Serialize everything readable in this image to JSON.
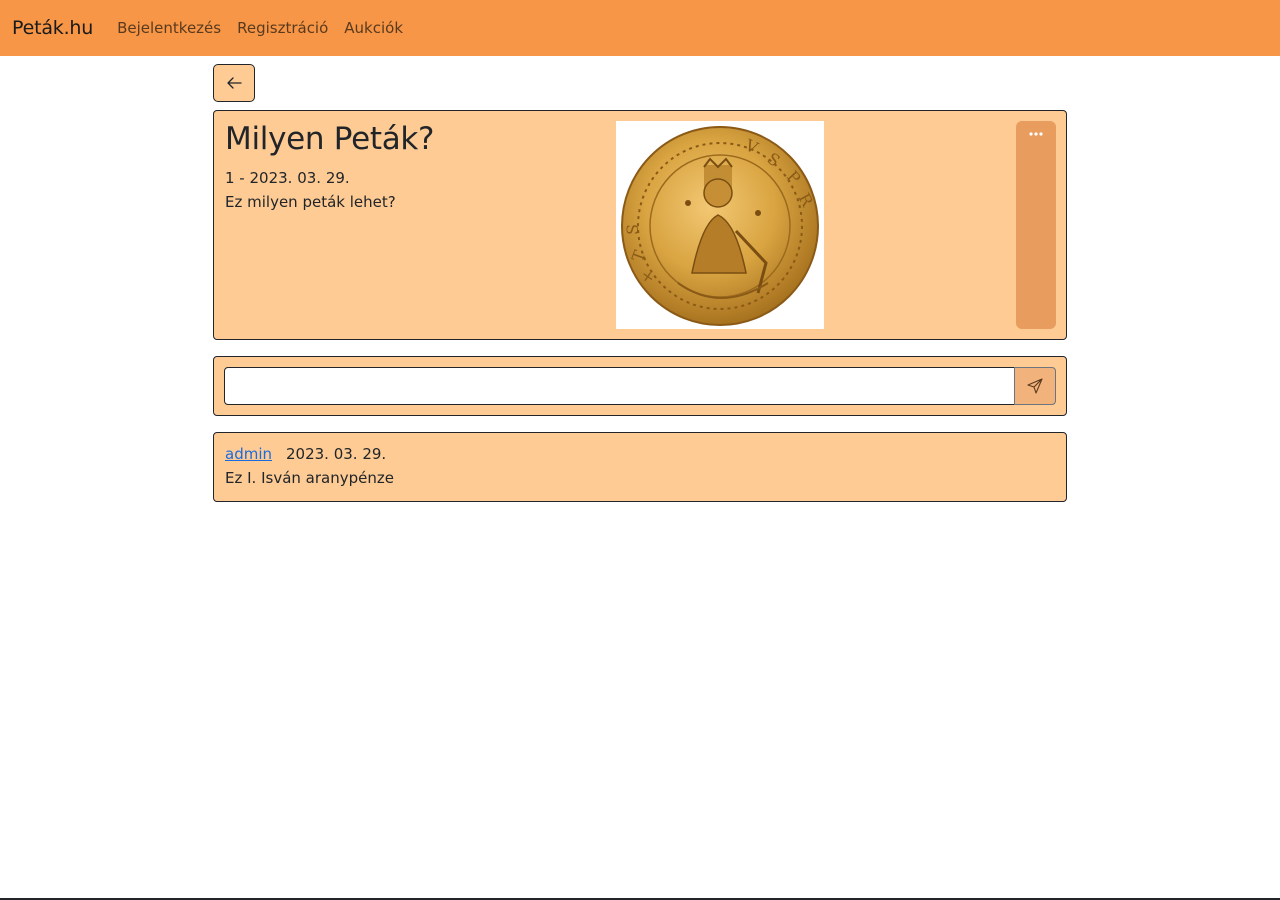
{
  "navbar": {
    "brand": "Peták.hu",
    "links": [
      "Bejelentkezés",
      "Regisztráció",
      "Aukciók"
    ]
  },
  "post": {
    "title": "Milyen Peták?",
    "meta": "1 - 2023. 03. 29.",
    "body": "Ez milyen peták lehet?",
    "image_subject": "gold coin"
  },
  "comment_form": {
    "value": "",
    "placeholder": ""
  },
  "comments": [
    {
      "author": "admin",
      "date": "2023. 03. 29.",
      "text": "Ez I. Isván aranypénze"
    }
  ],
  "colors": {
    "navbar": "#f79646",
    "card": "#fecb94",
    "more_button": "#e89c5e",
    "send_button": "#f2b27c",
    "link": "#1a6be0",
    "coin_gold": "#d9a441"
  },
  "icons": {
    "back": "arrow-left-icon",
    "more": "three-dots-icon",
    "send": "paper-plane-icon"
  }
}
